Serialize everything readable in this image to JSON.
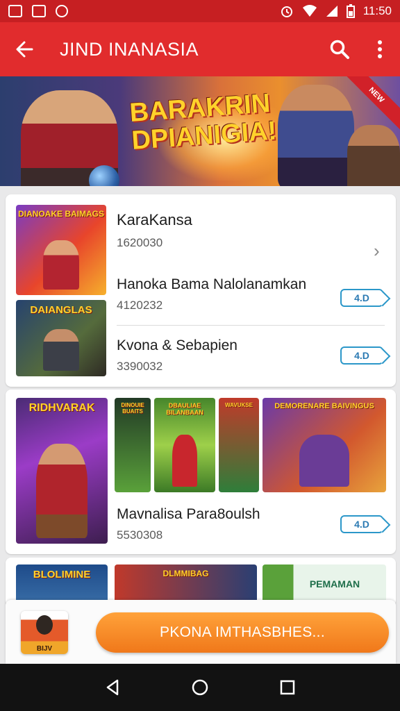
{
  "status_bar": {
    "time": "11:50"
  },
  "app_bar": {
    "title": "JIND INANASIA"
  },
  "banner": {
    "title": "BARAKRIN DPIANIGIA!",
    "ribbon": "NEW"
  },
  "card1": {
    "thumb_top_title": "DIANOAKE BAIMAGS",
    "thumb_bottom_title": "DAIANGLAS",
    "rows": [
      {
        "title": "KaraKansa",
        "sub": "1620030"
      },
      {
        "title": "Hanoka Bama Nalolanamkan",
        "sub": "4120232",
        "chip": "4.D"
      },
      {
        "title": "Kvona & Sebapien",
        "sub": "3390032",
        "chip": "4.D"
      }
    ]
  },
  "card2": {
    "big_thumb_title": "RIDHVARAK",
    "tile_titles": [
      "DINOUIE BUAITS",
      "DBAULIAE BILANBAAN",
      "WAVUKSE",
      "DEMORENARE BAIVINGUS"
    ],
    "row": {
      "title": "Mavnalisa Para8oulsh",
      "sub": "5530308",
      "chip": "4.D"
    }
  },
  "card3": {
    "tiles": [
      "BLOLIMINE",
      "DLMMIBAG",
      "PEMAMAN"
    ]
  },
  "bottom": {
    "avatar_label": "BIJV",
    "cta": "PKONA IMTHASBHES..."
  },
  "colors": {
    "primary": "#e12c2d",
    "status": "#c61f22",
    "accent": "#f0781a",
    "chip": "#2b97c9"
  }
}
